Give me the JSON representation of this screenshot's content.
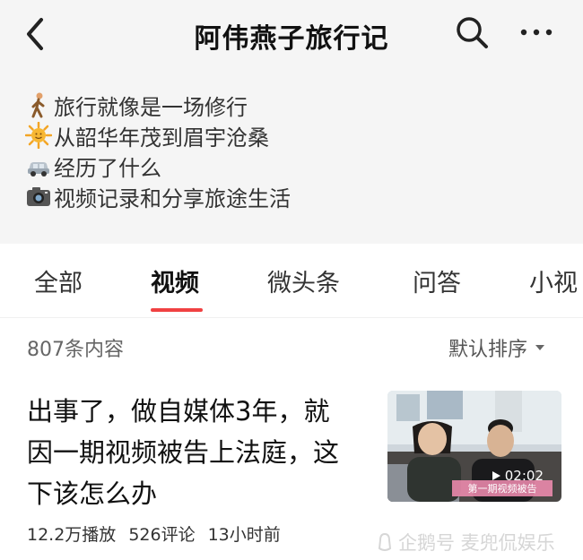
{
  "header": {
    "title": "阿伟燕子旅行记",
    "back_icon": "back-chevron-icon",
    "search_icon": "search-icon",
    "more_icon": "more-dots-icon"
  },
  "bio": {
    "lines": [
      {
        "emoji": "walking-person-icon",
        "text": "旅行就像是一场修行"
      },
      {
        "emoji": "sun-icon",
        "text": "从韶华年茂到眉宇沧桑"
      },
      {
        "emoji": "car-icon",
        "text": "经历了什么"
      },
      {
        "emoji": "camera-icon",
        "text": "视频记录和分享旅途生活"
      }
    ]
  },
  "tabs": [
    {
      "label": "全部",
      "active": false
    },
    {
      "label": "视频",
      "active": true
    },
    {
      "label": "微头条",
      "active": false
    },
    {
      "label": "问答",
      "active": false
    },
    {
      "label": "小视",
      "active": false
    }
  ],
  "list": {
    "count_text": "807条内容",
    "sort_label": "默认排序"
  },
  "item": {
    "title_lines": [
      "出事了，做自媒体3年，就",
      "因一期视频被告上法庭，这",
      "下该怎么办"
    ],
    "plays": "12.2万播放",
    "comments": "526评论",
    "time": "13小时前",
    "duration": "02:02",
    "thumb_caption": "第一期视频被告"
  },
  "watermark": {
    "text": "企鹅号 麦兜侃娱乐"
  },
  "colors": {
    "accent": "#f04142",
    "background": "#f5f5f5"
  }
}
